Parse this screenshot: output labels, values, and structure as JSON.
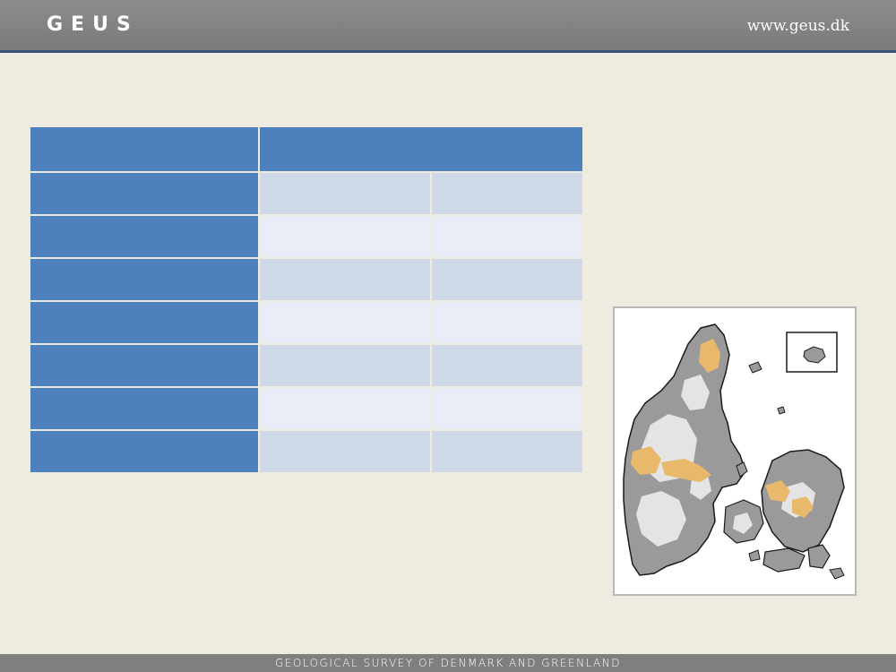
{
  "header": {
    "logo": "GEUS",
    "website": "www.geus.dk"
  },
  "footer": {
    "text": "GEOLOGICAL SURVEY OF DENMARK AND GREENLAND"
  },
  "table": {
    "rows": 7,
    "colors": {
      "header": "#4d81be",
      "shade_a": "#d0d9e8",
      "shade_b": "#e9edf5"
    }
  },
  "map": {
    "colors": {
      "land": "#9a9a9a",
      "light_area": "#e4e4e4",
      "highlight": "#e8b96a",
      "outline": "#1a1a1a"
    }
  }
}
